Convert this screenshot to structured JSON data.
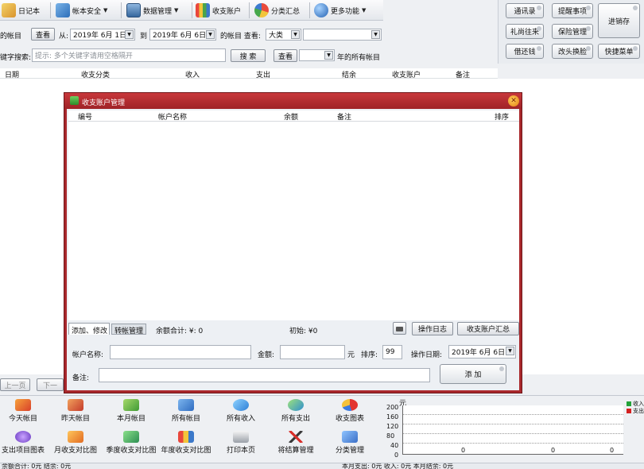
{
  "toolbar": {
    "items": [
      {
        "label": "日记本",
        "icon": "notebook-icon"
      },
      {
        "label": "帐本安全",
        "icon": "book-lock-icon",
        "arrow": "▼"
      },
      {
        "label": "数据管理",
        "icon": "monitor-icon",
        "arrow": "▼"
      },
      {
        "label": "收支账户",
        "icon": "bar-chart-icon"
      },
      {
        "label": "分类汇总",
        "icon": "colorful-pie-icon"
      },
      {
        "label": "更多功能",
        "icon": "globe-icon",
        "arrow": "▼"
      }
    ]
  },
  "right_panel": {
    "buttons": [
      "通讯录",
      "提醒事项",
      "礼尚往来",
      "保险管理",
      "借还钱",
      "改头换脸",
      "进销存",
      "快捷菜单"
    ]
  },
  "filter": {
    "period_label": "的帐目",
    "view_button": "查看",
    "from_label": "从:",
    "from_date": "2019年 6月 1日",
    "to_label": "到",
    "to_date": "2019年 6月 6日",
    "account_label": "的帐目 查看:",
    "category_value": "大类",
    "sub_value": ""
  },
  "search": {
    "label": "键字搜索:",
    "placeholder": "提示: 多个关键字请用空格隔开",
    "search_button": "搜 索",
    "view_button": "查看",
    "year_value": "",
    "year_suffix": "年的所有帐目"
  },
  "main_table": {
    "columns": [
      "日期",
      "收支分类",
      "收入",
      "支出",
      "结余",
      "收支账户",
      "备注"
    ]
  },
  "dialog": {
    "title": "收支账户管理",
    "columns": [
      "编号",
      "帐户名称",
      "余额",
      "备注",
      "排序"
    ],
    "tabs": [
      "添加、修改",
      "转帐管理"
    ],
    "total_label": "余额合计: ¥: 0",
    "initial_label": "初始: ¥0",
    "log_button": "操作日志",
    "summary_button": "收支账户汇总",
    "name_label": "帐户名称:",
    "name_value": "",
    "amount_label": "金额:",
    "amount_value": "",
    "unit_label": "元",
    "order_label": "排序:",
    "order_value": "99",
    "date_label": "操作日期:",
    "date_value": "2019年 6月 6日",
    "note_label": "备注:",
    "note_value": "",
    "add_button": "添 加"
  },
  "pager": {
    "prev": "上一页",
    "next": "下一"
  },
  "footer": {
    "row1": [
      {
        "label": "今天帐目",
        "icon": "today-icon"
      },
      {
        "label": "昨天帐目",
        "icon": "yesterday-icon"
      },
      {
        "label": "本月帐目",
        "icon": "month-icon"
      },
      {
        "label": "所有帐目",
        "icon": "all-accounts-icon"
      },
      {
        "label": "所有收入",
        "icon": "income-icon"
      },
      {
        "label": "所有支出",
        "icon": "expense-icon"
      },
      {
        "label": "收支图表",
        "icon": "pie-chart-icon"
      }
    ],
    "row2": [
      {
        "label": "支出项目图表",
        "icon": "chart-icon"
      },
      {
        "label": "月收支对比图",
        "icon": "monthly-compare-icon"
      },
      {
        "label": "季度收支对比图",
        "icon": "quarter-compare-icon"
      },
      {
        "label": "年度收支对比图",
        "icon": "annual-compare-icon"
      },
      {
        "label": "打印本页",
        "icon": "print-icon"
      },
      {
        "label": "将结算管理",
        "icon": "settle-icon"
      },
      {
        "label": "分类管理",
        "icon": "category-icon"
      }
    ]
  },
  "mini_chart": {
    "unit": "元",
    "ticks": [
      "200",
      "160",
      "120",
      "80",
      "40",
      "0"
    ],
    "values_label": [
      "0",
      "0",
      "0"
    ],
    "legend": [
      "收入",
      "支出"
    ],
    "colors": {
      "income": "#22a23a",
      "expense": "#d42020"
    }
  },
  "status": {
    "left": "余额合计: 0元 结余: 0元",
    "right": "本月支出: 0元 收入: 0元 本月结余: 0元"
  }
}
